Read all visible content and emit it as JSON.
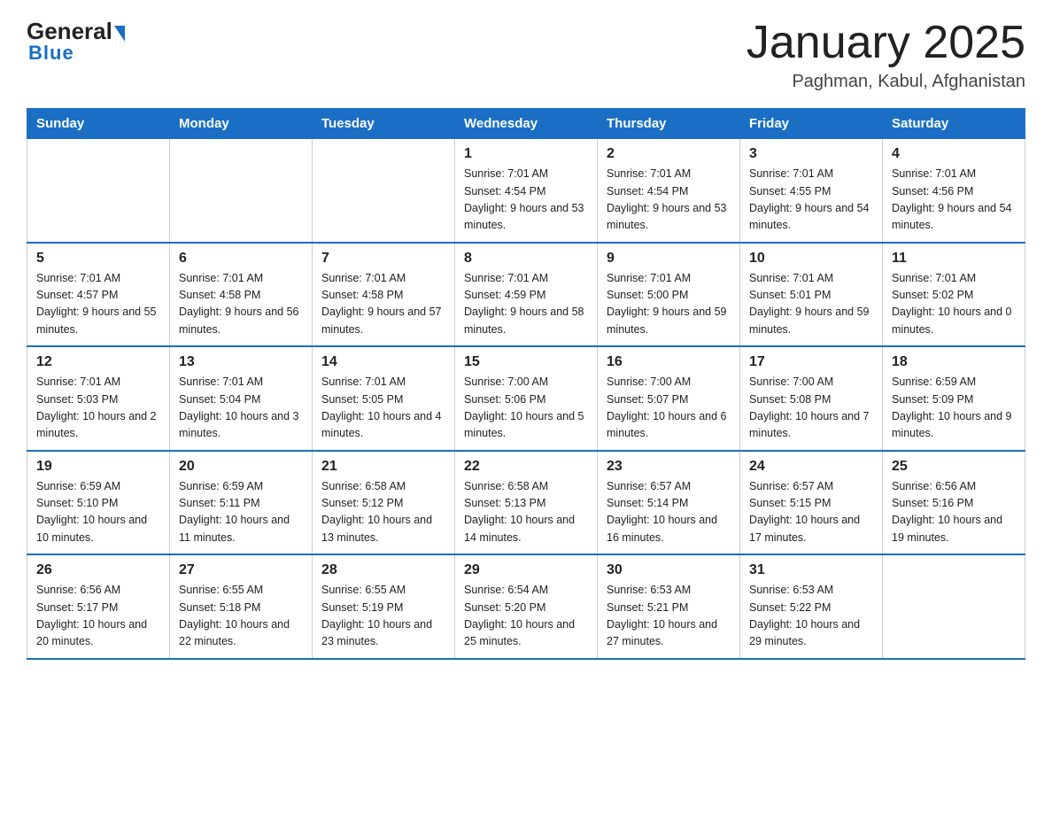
{
  "header": {
    "logo_general": "General",
    "logo_blue": "Blue",
    "month_title": "January 2025",
    "location": "Paghman, Kabul, Afghanistan"
  },
  "weekdays": [
    "Sunday",
    "Monday",
    "Tuesday",
    "Wednesday",
    "Thursday",
    "Friday",
    "Saturday"
  ],
  "weeks": [
    [
      {
        "day": "",
        "sunrise": "",
        "sunset": "",
        "daylight": ""
      },
      {
        "day": "",
        "sunrise": "",
        "sunset": "",
        "daylight": ""
      },
      {
        "day": "",
        "sunrise": "",
        "sunset": "",
        "daylight": ""
      },
      {
        "day": "1",
        "sunrise": "Sunrise: 7:01 AM",
        "sunset": "Sunset: 4:54 PM",
        "daylight": "Daylight: 9 hours and 53 minutes."
      },
      {
        "day": "2",
        "sunrise": "Sunrise: 7:01 AM",
        "sunset": "Sunset: 4:54 PM",
        "daylight": "Daylight: 9 hours and 53 minutes."
      },
      {
        "day": "3",
        "sunrise": "Sunrise: 7:01 AM",
        "sunset": "Sunset: 4:55 PM",
        "daylight": "Daylight: 9 hours and 54 minutes."
      },
      {
        "day": "4",
        "sunrise": "Sunrise: 7:01 AM",
        "sunset": "Sunset: 4:56 PM",
        "daylight": "Daylight: 9 hours and 54 minutes."
      }
    ],
    [
      {
        "day": "5",
        "sunrise": "Sunrise: 7:01 AM",
        "sunset": "Sunset: 4:57 PM",
        "daylight": "Daylight: 9 hours and 55 minutes."
      },
      {
        "day": "6",
        "sunrise": "Sunrise: 7:01 AM",
        "sunset": "Sunset: 4:58 PM",
        "daylight": "Daylight: 9 hours and 56 minutes."
      },
      {
        "day": "7",
        "sunrise": "Sunrise: 7:01 AM",
        "sunset": "Sunset: 4:58 PM",
        "daylight": "Daylight: 9 hours and 57 minutes."
      },
      {
        "day": "8",
        "sunrise": "Sunrise: 7:01 AM",
        "sunset": "Sunset: 4:59 PM",
        "daylight": "Daylight: 9 hours and 58 minutes."
      },
      {
        "day": "9",
        "sunrise": "Sunrise: 7:01 AM",
        "sunset": "Sunset: 5:00 PM",
        "daylight": "Daylight: 9 hours and 59 minutes."
      },
      {
        "day": "10",
        "sunrise": "Sunrise: 7:01 AM",
        "sunset": "Sunset: 5:01 PM",
        "daylight": "Daylight: 9 hours and 59 minutes."
      },
      {
        "day": "11",
        "sunrise": "Sunrise: 7:01 AM",
        "sunset": "Sunset: 5:02 PM",
        "daylight": "Daylight: 10 hours and 0 minutes."
      }
    ],
    [
      {
        "day": "12",
        "sunrise": "Sunrise: 7:01 AM",
        "sunset": "Sunset: 5:03 PM",
        "daylight": "Daylight: 10 hours and 2 minutes."
      },
      {
        "day": "13",
        "sunrise": "Sunrise: 7:01 AM",
        "sunset": "Sunset: 5:04 PM",
        "daylight": "Daylight: 10 hours and 3 minutes."
      },
      {
        "day": "14",
        "sunrise": "Sunrise: 7:01 AM",
        "sunset": "Sunset: 5:05 PM",
        "daylight": "Daylight: 10 hours and 4 minutes."
      },
      {
        "day": "15",
        "sunrise": "Sunrise: 7:00 AM",
        "sunset": "Sunset: 5:06 PM",
        "daylight": "Daylight: 10 hours and 5 minutes."
      },
      {
        "day": "16",
        "sunrise": "Sunrise: 7:00 AM",
        "sunset": "Sunset: 5:07 PM",
        "daylight": "Daylight: 10 hours and 6 minutes."
      },
      {
        "day": "17",
        "sunrise": "Sunrise: 7:00 AM",
        "sunset": "Sunset: 5:08 PM",
        "daylight": "Daylight: 10 hours and 7 minutes."
      },
      {
        "day": "18",
        "sunrise": "Sunrise: 6:59 AM",
        "sunset": "Sunset: 5:09 PM",
        "daylight": "Daylight: 10 hours and 9 minutes."
      }
    ],
    [
      {
        "day": "19",
        "sunrise": "Sunrise: 6:59 AM",
        "sunset": "Sunset: 5:10 PM",
        "daylight": "Daylight: 10 hours and 10 minutes."
      },
      {
        "day": "20",
        "sunrise": "Sunrise: 6:59 AM",
        "sunset": "Sunset: 5:11 PM",
        "daylight": "Daylight: 10 hours and 11 minutes."
      },
      {
        "day": "21",
        "sunrise": "Sunrise: 6:58 AM",
        "sunset": "Sunset: 5:12 PM",
        "daylight": "Daylight: 10 hours and 13 minutes."
      },
      {
        "day": "22",
        "sunrise": "Sunrise: 6:58 AM",
        "sunset": "Sunset: 5:13 PM",
        "daylight": "Daylight: 10 hours and 14 minutes."
      },
      {
        "day": "23",
        "sunrise": "Sunrise: 6:57 AM",
        "sunset": "Sunset: 5:14 PM",
        "daylight": "Daylight: 10 hours and 16 minutes."
      },
      {
        "day": "24",
        "sunrise": "Sunrise: 6:57 AM",
        "sunset": "Sunset: 5:15 PM",
        "daylight": "Daylight: 10 hours and 17 minutes."
      },
      {
        "day": "25",
        "sunrise": "Sunrise: 6:56 AM",
        "sunset": "Sunset: 5:16 PM",
        "daylight": "Daylight: 10 hours and 19 minutes."
      }
    ],
    [
      {
        "day": "26",
        "sunrise": "Sunrise: 6:56 AM",
        "sunset": "Sunset: 5:17 PM",
        "daylight": "Daylight: 10 hours and 20 minutes."
      },
      {
        "day": "27",
        "sunrise": "Sunrise: 6:55 AM",
        "sunset": "Sunset: 5:18 PM",
        "daylight": "Daylight: 10 hours and 22 minutes."
      },
      {
        "day": "28",
        "sunrise": "Sunrise: 6:55 AM",
        "sunset": "Sunset: 5:19 PM",
        "daylight": "Daylight: 10 hours and 23 minutes."
      },
      {
        "day": "29",
        "sunrise": "Sunrise: 6:54 AM",
        "sunset": "Sunset: 5:20 PM",
        "daylight": "Daylight: 10 hours and 25 minutes."
      },
      {
        "day": "30",
        "sunrise": "Sunrise: 6:53 AM",
        "sunset": "Sunset: 5:21 PM",
        "daylight": "Daylight: 10 hours and 27 minutes."
      },
      {
        "day": "31",
        "sunrise": "Sunrise: 6:53 AM",
        "sunset": "Sunset: 5:22 PM",
        "daylight": "Daylight: 10 hours and 29 minutes."
      },
      {
        "day": "",
        "sunrise": "",
        "sunset": "",
        "daylight": ""
      }
    ]
  ]
}
